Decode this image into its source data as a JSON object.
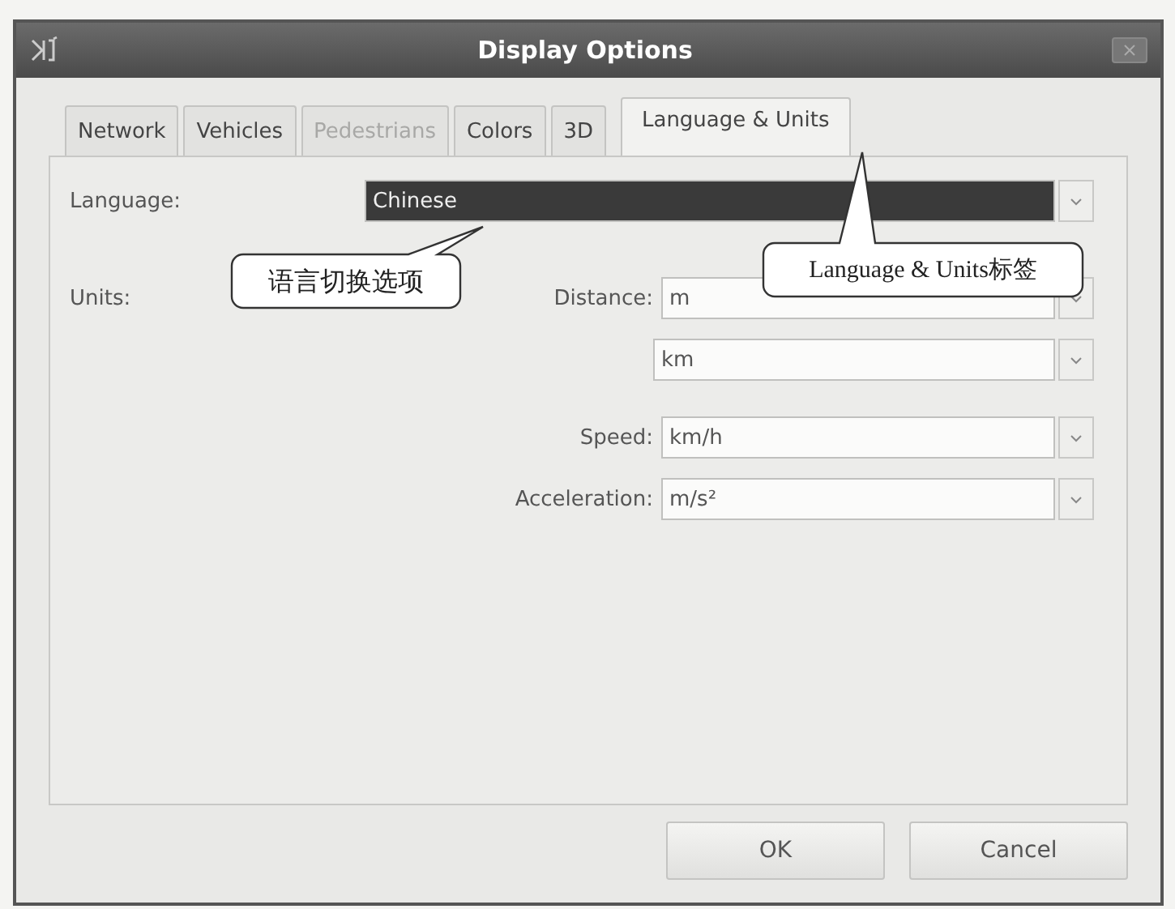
{
  "window": {
    "title": "Display Options"
  },
  "tabs": [
    {
      "label": "Network",
      "selected": false,
      "disabled": false
    },
    {
      "label": "Vehicles",
      "selected": false,
      "disabled": false
    },
    {
      "label": "Pedestrians",
      "selected": false,
      "disabled": true
    },
    {
      "label": "Colors",
      "selected": false,
      "disabled": false
    },
    {
      "label": "3D",
      "selected": false,
      "disabled": false
    },
    {
      "label": "Language & Units",
      "selected": true,
      "disabled": false
    }
  ],
  "language": {
    "label": "Language:",
    "value": "Chinese",
    "highlighted": true
  },
  "units": {
    "label": "Units:",
    "fields": [
      {
        "label": "Distance:",
        "value": "m"
      },
      {
        "value": "km"
      },
      {
        "label": "Speed:",
        "value": "km/h"
      },
      {
        "label": "Acceleration:",
        "value": "m/s²"
      }
    ]
  },
  "callouts": [
    {
      "text": "语言切换选项"
    },
    {
      "text": "Language & Units标签"
    }
  ],
  "buttons": [
    "OK",
    "Cancel"
  ]
}
